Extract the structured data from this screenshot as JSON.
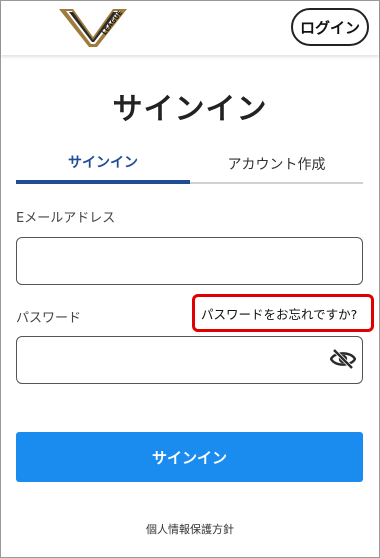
{
  "header": {
    "logo_text": "LEAGUE",
    "login_label": "ログイン"
  },
  "page": {
    "title": "サインイン"
  },
  "tabs": [
    {
      "label": "サインイン",
      "active": true
    },
    {
      "label": "アカウント作成",
      "active": false
    }
  ],
  "form": {
    "email_label": "Eメールアドレス",
    "email_value": "",
    "password_label": "パスワード",
    "password_value": "",
    "forgot_label": "パスワードをお忘れですか?",
    "submit_label": "サインイン"
  },
  "footer": {
    "privacy_label": "個人情報保護方針"
  },
  "colors": {
    "accent_blue": "#1a8cf0",
    "tab_active": "#1f4e95",
    "highlight_red": "#e00000",
    "logo_gold": "#a07c3c"
  },
  "icons": {
    "logo": "league-logo",
    "password_toggle": "eye-slash-icon"
  }
}
